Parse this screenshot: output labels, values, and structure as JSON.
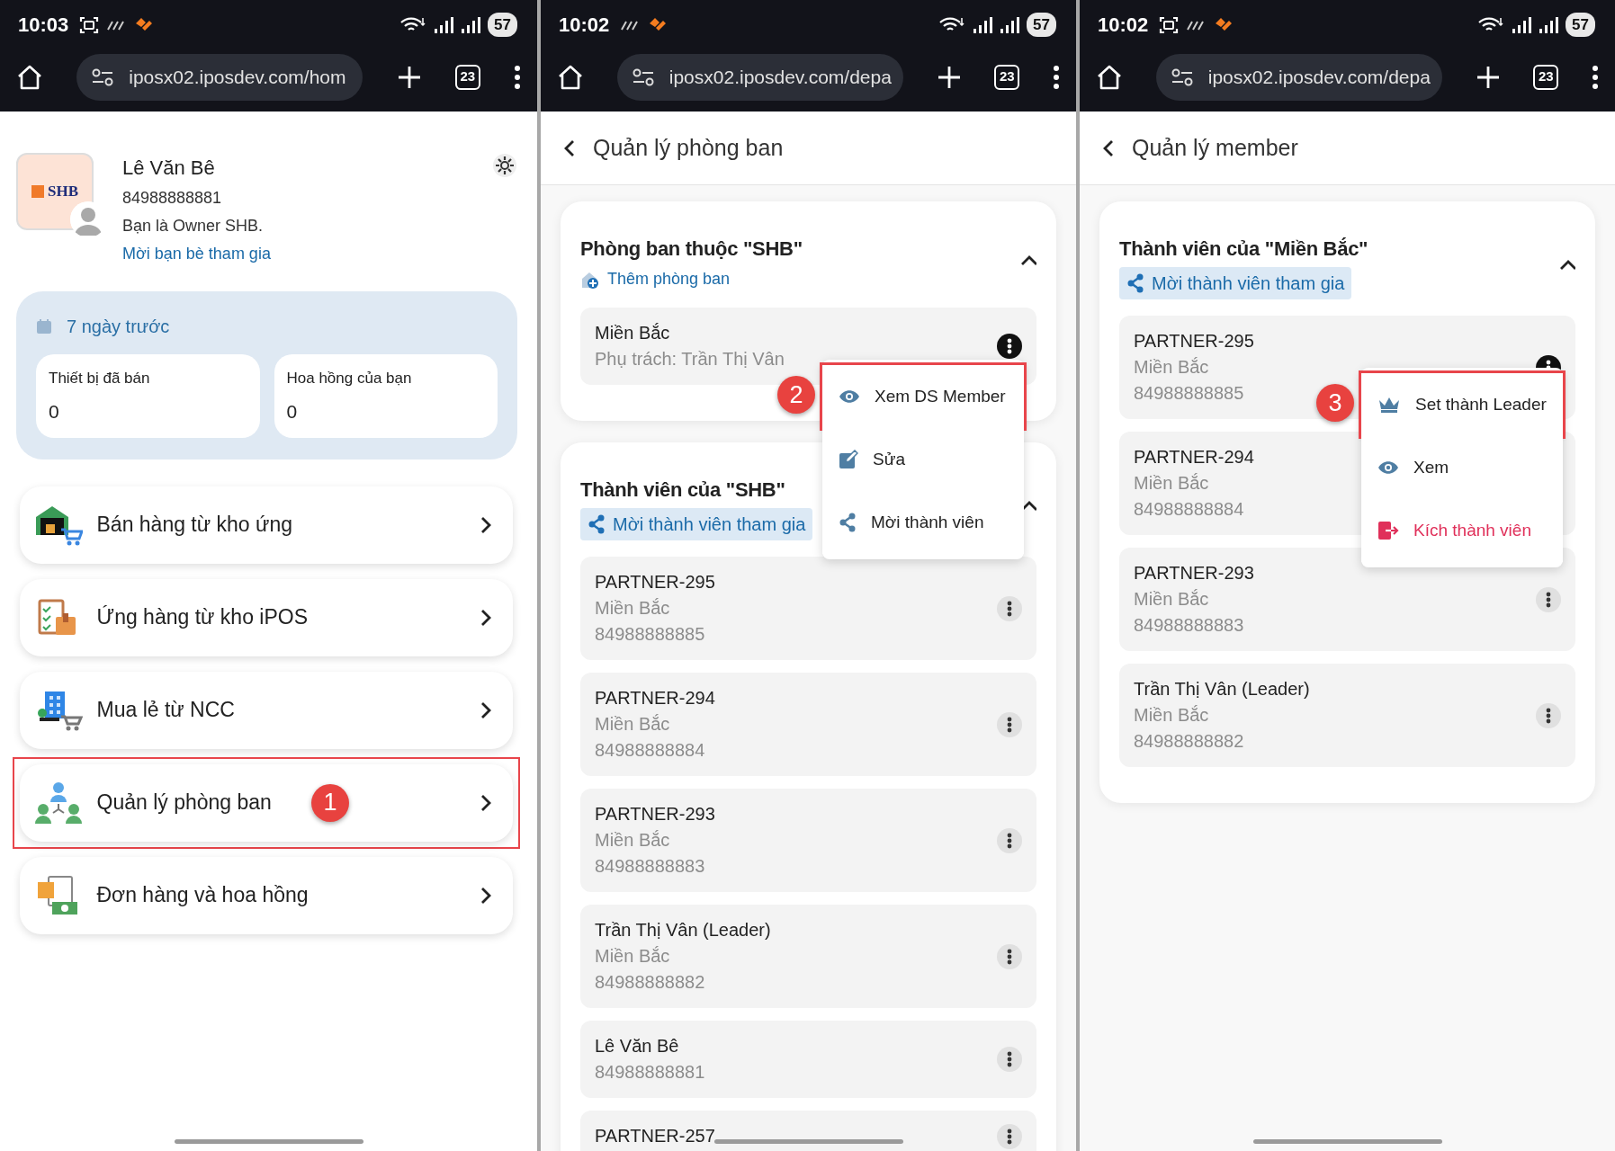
{
  "panels": [
    {
      "kind": "home",
      "status_bar": {
        "time": "10:03",
        "notification_icons": [
          {
            "kind": "screenshot"
          },
          {
            "kind": "data"
          },
          {
            "kind": "app"
          }
        ],
        "battery": "57"
      },
      "browser_bar": {
        "url": "iposx02.iposdev.com/hom",
        "tab_count": "23"
      },
      "profile": {
        "logo_text": "SHB",
        "name": "Lê Văn Bê",
        "phone": "84988888881",
        "role": "Bạn là Owner SHB.",
        "invite_link": "Mời bạn bè tham gia"
      },
      "stats": {
        "period": "7 ngày trước",
        "tiles": [
          {
            "label": "Thiết bị đã bán",
            "value": "0"
          },
          {
            "label": "Hoa hồng của bạn",
            "value": "0"
          }
        ]
      },
      "menu": [
        {
          "label": "Bán hàng từ kho ứng",
          "kind": "warehouse",
          "highlighted": false
        },
        {
          "label": "Ứng hàng từ kho iPOS",
          "kind": "clipboard",
          "highlighted": false
        },
        {
          "label": "Mua lẻ từ NCC",
          "kind": "building",
          "highlighted": false
        },
        {
          "label": "Quản lý phòng ban",
          "kind": "team",
          "highlighted": true,
          "step": "1"
        },
        {
          "label": "Đơn hàng và hoa hồng",
          "kind": "money",
          "highlighted": false
        }
      ]
    },
    {
      "kind": "list",
      "status_bar": {
        "time": "10:02",
        "notification_icons": [
          {
            "kind": "data"
          },
          {
            "kind": "app"
          }
        ],
        "battery": "57"
      },
      "browser_bar": {
        "url": "iposx02.iposdev.com/depa",
        "tab_count": "23"
      },
      "header": {
        "title": "Quản lý phòng ban"
      },
      "sections": [
        {
          "title": "Phòng ban thuộc \"SHB\"",
          "expanded": true,
          "action": {
            "label": "Thêm phòng ban",
            "kind": "add"
          },
          "items": [
            {
              "lines": [
                "Miền Bắc",
                "Phụ trách: Trần Thị Vân"
              ],
              "menu_open": true,
              "menu": [
                {
                  "label": "Xem DS Member",
                  "kind": "view",
                  "highlighted": true,
                  "step": "2"
                },
                {
                  "label": "Sửa",
                  "kind": "edit",
                  "highlighted": false
                },
                {
                  "label": "Mời thành viên",
                  "kind": "share",
                  "highlighted": false
                }
              ]
            }
          ]
        },
        {
          "title": "Thành viên của \"SHB\"",
          "expanded": true,
          "action": {
            "label": "Mời thành viên tham gia",
            "kind": "share"
          },
          "items": [
            {
              "lines": [
                "PARTNER-295",
                "Miền Bắc",
                "84988888885"
              ],
              "menu_open": false
            },
            {
              "lines": [
                "PARTNER-294",
                "Miền Bắc",
                "84988888884"
              ],
              "menu_open": false
            },
            {
              "lines": [
                "PARTNER-293",
                "Miền Bắc",
                "84988888883"
              ],
              "menu_open": false
            },
            {
              "lines": [
                "Trần Thị Vân (Leader)",
                "Miền Bắc",
                "84988888882"
              ],
              "menu_open": false
            },
            {
              "lines": [
                "Lê Văn Bê",
                "84988888881"
              ],
              "menu_open": false
            },
            {
              "lines": [
                "PARTNER-257"
              ],
              "menu_open": false
            }
          ]
        }
      ]
    },
    {
      "kind": "list",
      "status_bar": {
        "time": "10:02",
        "notification_icons": [
          {
            "kind": "screenshot"
          },
          {
            "kind": "data"
          },
          {
            "kind": "app"
          }
        ],
        "battery": "57"
      },
      "browser_bar": {
        "url": "iposx02.iposdev.com/depa",
        "tab_count": "23"
      },
      "header": {
        "title": "Quản lý member"
      },
      "sections": [
        {
          "title": "Thành viên của \"Miền Bắc\"",
          "expanded": true,
          "action": {
            "label": "Mời thành viên tham gia",
            "kind": "share"
          },
          "items": [
            {
              "lines": [
                "PARTNER-295",
                "Miền Bắc",
                "84988888885"
              ],
              "menu_open": true,
              "menu": [
                {
                  "label": "Set thành Leader",
                  "kind": "crown",
                  "highlighted": true,
                  "step": "3"
                },
                {
                  "label": "Xem",
                  "kind": "view",
                  "highlighted": false
                },
                {
                  "label": "Kích thành viên",
                  "kind": "kick",
                  "highlighted": false
                }
              ]
            },
            {
              "lines": [
                "PARTNER-294",
                "Miền Bắc",
                "84988888884"
              ]
            },
            {
              "lines": [
                "PARTNER-293",
                "Miền Bắc",
                "84988888883"
              ],
              "menu_open": false
            },
            {
              "lines": [
                "Trần Thị Vân (Leader)",
                "Miền Bắc",
                "84988888882"
              ],
              "menu_open": false
            }
          ]
        }
      ]
    }
  ]
}
